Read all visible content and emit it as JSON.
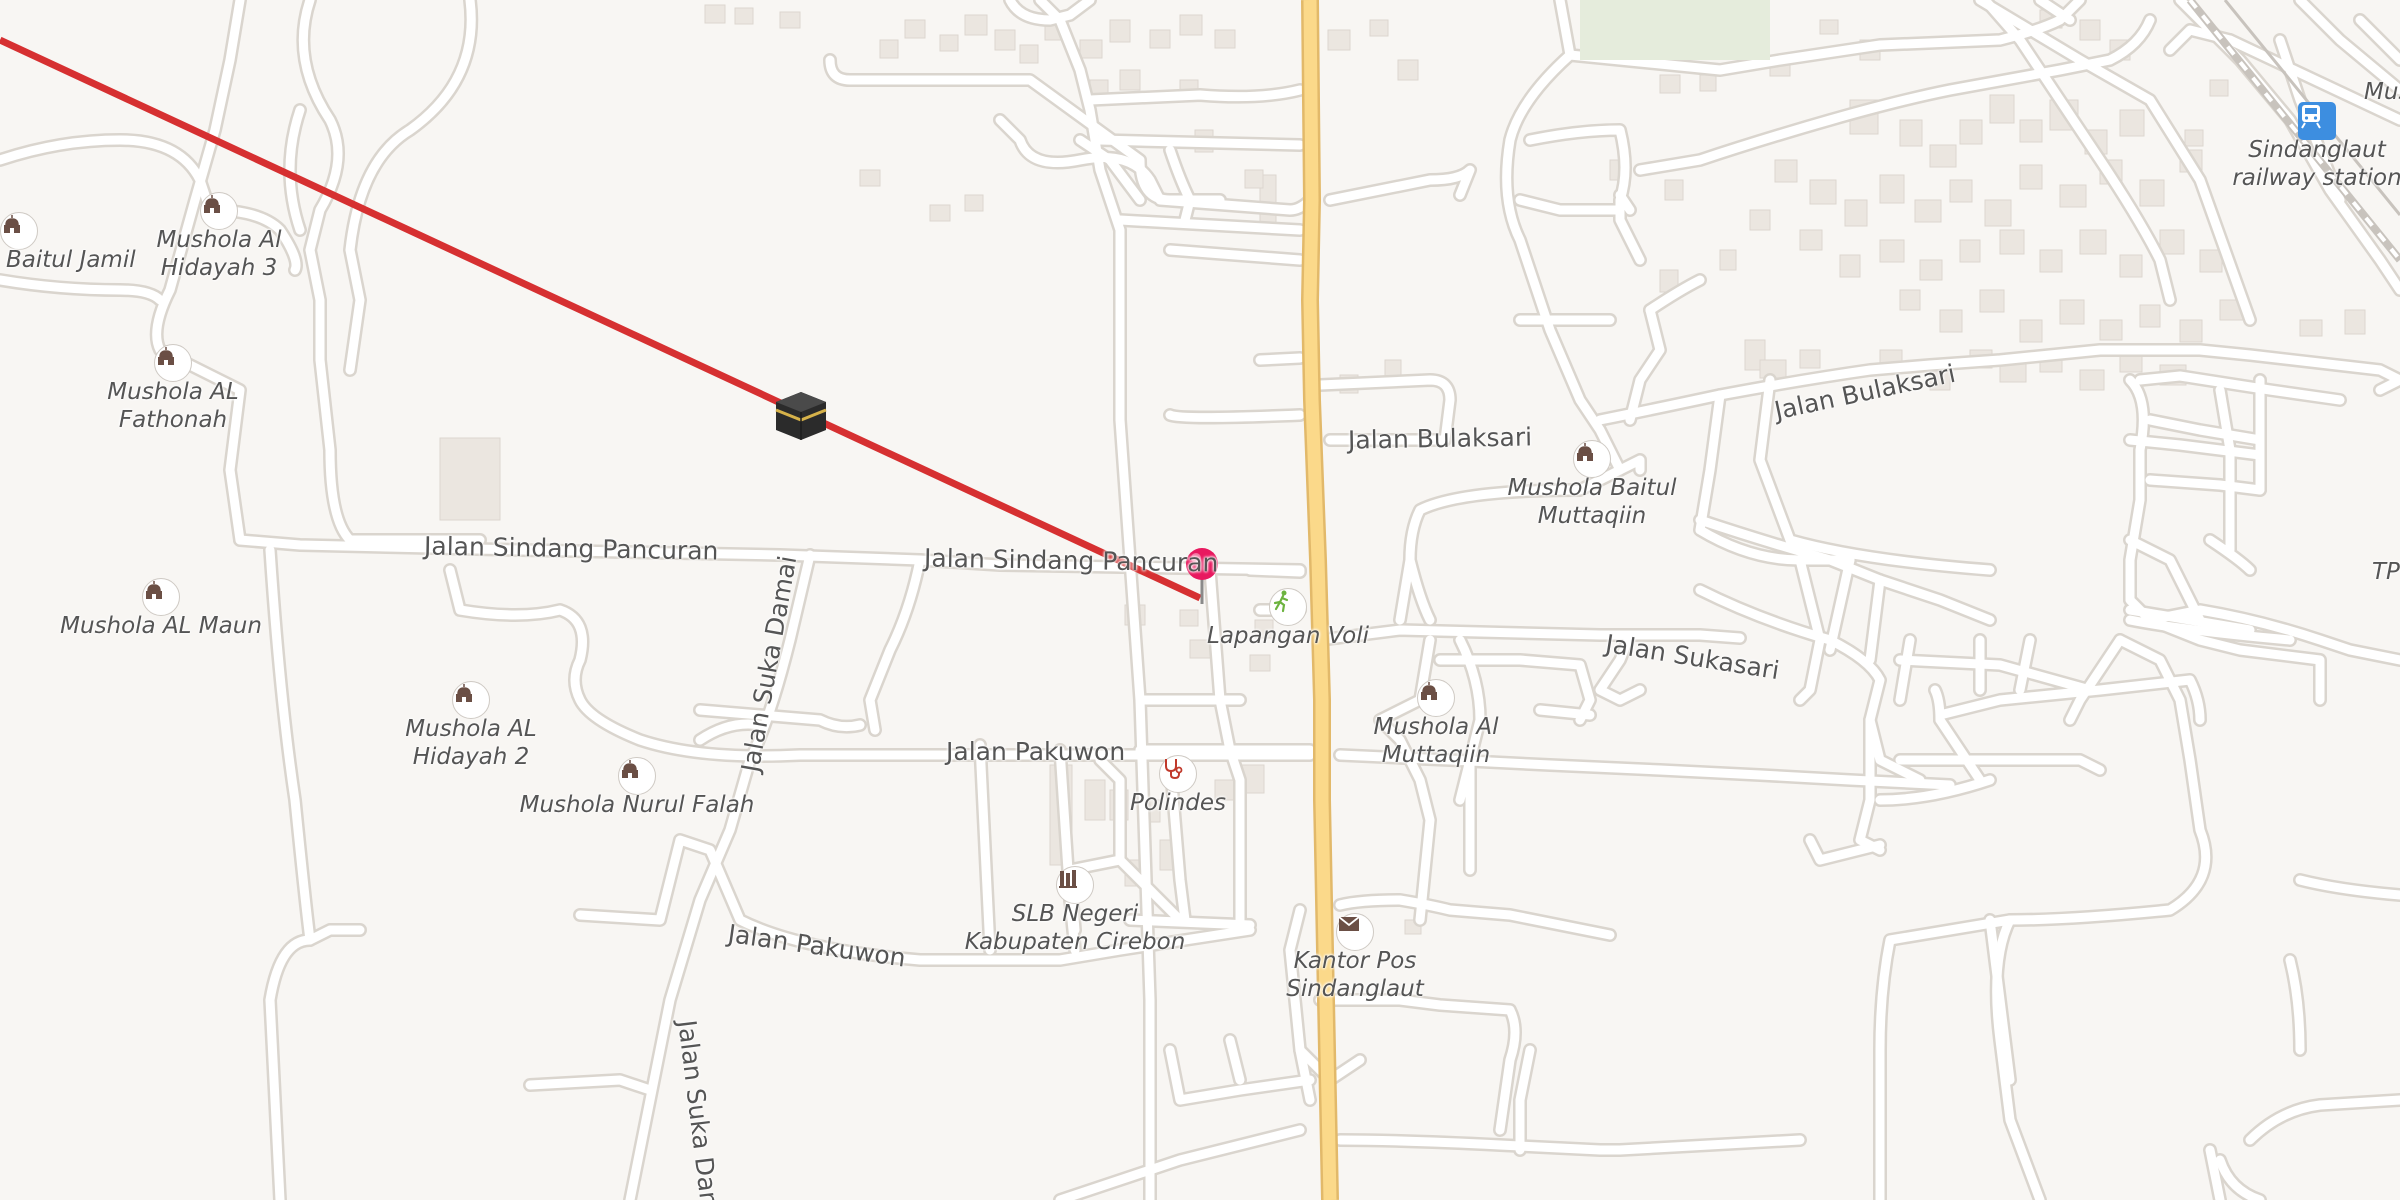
{
  "map": {
    "streets": {
      "sindang_pancuran_west": "Jalan Sindang Pancuran",
      "sindang_pancuran_east": "Jalan Sindang Pancuran",
      "pakuwon_north": "Jalan Pakuwon",
      "pakuwon_south": "Jalan Pakuwon",
      "suka_damai_north": "Jalan Suka Damai",
      "suka_damai_south": "Jalan Suka Damai",
      "bulaksari_west": "Jalan Bulaksari",
      "bulaksari_east": "Jalan Bulaksari",
      "sukasari": "Jalan Sukasari"
    },
    "pois": [
      {
        "id": "baitul-jamil",
        "label": "Baitul Jamil",
        "icon": "mosque-icon"
      },
      {
        "id": "mushola-al-hidayah-3",
        "label": "Mushola Al\nHidayah 3",
        "icon": "mosque-icon"
      },
      {
        "id": "mushola-al-fathonah",
        "label": "Mushola AL\nFathonah",
        "icon": "mosque-icon"
      },
      {
        "id": "mushola-al-maun",
        "label": "Mushola AL Maun",
        "icon": "mosque-icon"
      },
      {
        "id": "mushola-al-hidayah-2",
        "label": "Mushola AL\nHidayah 2",
        "icon": "mosque-icon"
      },
      {
        "id": "mushola-nurul-falah",
        "label": "Mushola Nurul Falah",
        "icon": "mosque-icon"
      },
      {
        "id": "lapangan-voli",
        "label": "Lapangan Voli",
        "icon": "volleyball-icon"
      },
      {
        "id": "polindes",
        "label": "Polindes",
        "icon": "stethoscope-icon"
      },
      {
        "id": "slb-negeri",
        "label": "SLB Negeri\nKabupaten Cirebon",
        "icon": "school-icon"
      },
      {
        "id": "kantor-pos",
        "label": "Kantor Pos\nSindanglaut",
        "icon": "mail-icon"
      },
      {
        "id": "mushola-al-muttaqiin",
        "label": "Mushola Al\nMuttaqiin",
        "icon": "mosque-icon"
      },
      {
        "id": "mushola-baitul-muttaqiin",
        "label": "Mushola Baitul\nMuttaqiin",
        "icon": "mosque-icon"
      },
      {
        "id": "sindanglaut-railway-station",
        "label": "Sindanglaut\nrailway station",
        "icon": "train-icon"
      }
    ],
    "edge_labels": {
      "top_right": "Mus",
      "right": "TP"
    },
    "qibla_marker_icon": "kaaba-icon",
    "location_pin_icon": "location-pin-icon",
    "colors": {
      "background": "#f8f6f3",
      "road": "#ffffff",
      "road_casing": "#dedad4",
      "main_road": "#fbd98a",
      "qibla_line": "#d63031",
      "pin": "#e8195f",
      "building": "#ece7e1"
    }
  }
}
